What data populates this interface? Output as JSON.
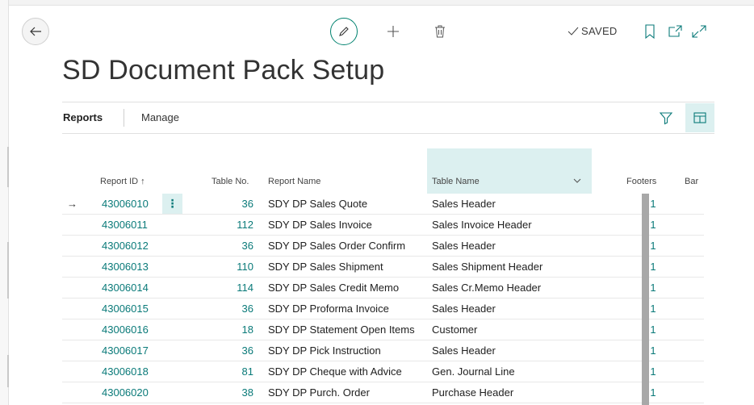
{
  "header": {
    "saved_label": "SAVED",
    "title": "SD Document Pack Setup",
    "icons": [
      "back-arrow-icon",
      "edit-pencil-icon",
      "plus-icon",
      "trash-icon",
      "checkmark-icon",
      "bookmark-icon",
      "popout-icon",
      "expand-icon"
    ]
  },
  "tabs": {
    "reports": "Reports",
    "manage": "Manage"
  },
  "columns": {
    "report_id": "Report ID ↑",
    "table_no": "Table No.",
    "report_name": "Report Name",
    "table_name": "Table Name",
    "footers": "Footers",
    "bar": "Bar"
  },
  "rows": [
    {
      "report_id": "43006010",
      "table_no": "36",
      "report_name": "SDY DP Sales Quote",
      "table_name": "Sales Header",
      "footers": "1"
    },
    {
      "report_id": "43006011",
      "table_no": "112",
      "report_name": "SDY DP Sales Invoice",
      "table_name": "Sales Invoice Header",
      "footers": "1"
    },
    {
      "report_id": "43006012",
      "table_no": "36",
      "report_name": "SDY DP Sales Order Confirm",
      "table_name": "Sales Header",
      "footers": "1"
    },
    {
      "report_id": "43006013",
      "table_no": "110",
      "report_name": "SDY DP Sales Shipment",
      "table_name": "Sales Shipment Header",
      "footers": "1"
    },
    {
      "report_id": "43006014",
      "table_no": "114",
      "report_name": "SDY DP Sales Credit Memo",
      "table_name": "Sales Cr.Memo Header",
      "footers": "1"
    },
    {
      "report_id": "43006015",
      "table_no": "36",
      "report_name": "SDY DP Proforma Invoice",
      "table_name": "Sales Header",
      "footers": "1"
    },
    {
      "report_id": "43006016",
      "table_no": "18",
      "report_name": "SDY DP Statement Open Items",
      "table_name": "Customer",
      "footers": "1"
    },
    {
      "report_id": "43006017",
      "table_no": "36",
      "report_name": "SDY DP Pick Instruction",
      "table_name": "Sales Header",
      "footers": "1"
    },
    {
      "report_id": "43006018",
      "table_no": "81",
      "report_name": "SDY DP Cheque with Advice",
      "table_name": "Gen. Journal Line",
      "footers": "1"
    },
    {
      "report_id": "43006020",
      "table_no": "38",
      "report_name": "SDY DP Purch. Order",
      "table_name": "Purchase Header",
      "footers": "1"
    }
  ],
  "colors": {
    "accent": "#00826f",
    "link": "#0a7a79",
    "highlight": "#dcf0f0"
  }
}
